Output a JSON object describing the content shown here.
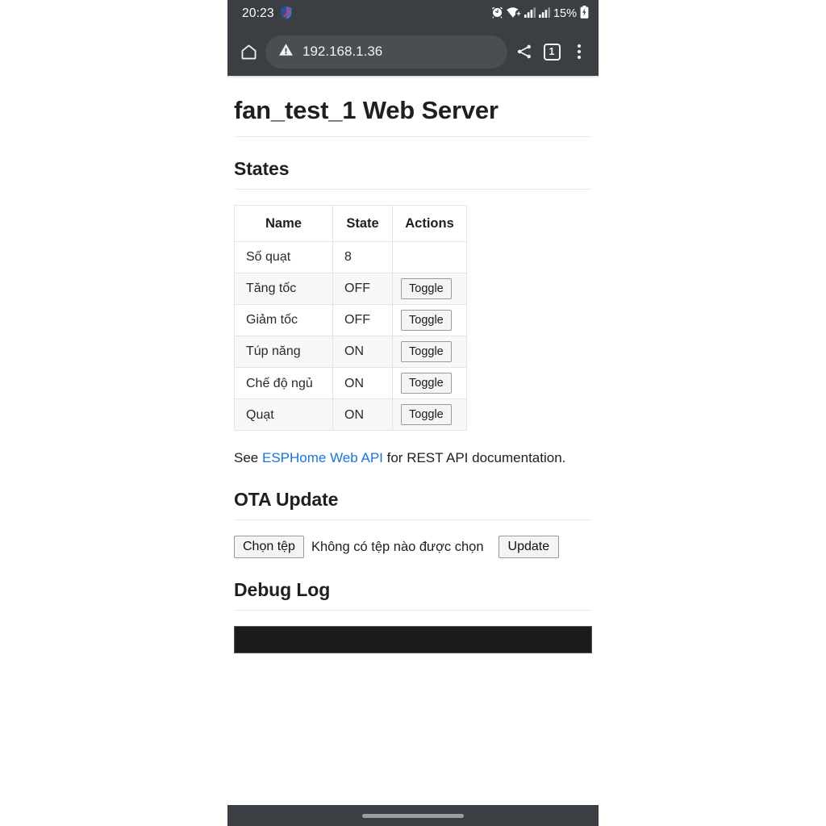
{
  "statusbar": {
    "clock": "20:23",
    "icons_left": [
      "shield-icon"
    ],
    "battery_percent": "15%",
    "icons_right": [
      "alarm-icon",
      "wifi-icon",
      "signal-bars-icon",
      "signal-bars-2-icon",
      "battery-charging-icon"
    ]
  },
  "browser": {
    "home_icon": "home-icon",
    "security_icon": "warning-triangle-icon",
    "url": "192.168.1.36",
    "share_icon": "share-icon",
    "tab_count": "1",
    "menu_icon": "kebab-menu-icon"
  },
  "page": {
    "title": "fan_test_1 Web Server",
    "states_heading": "States",
    "ota_heading": "OTA Update",
    "debug_heading": "Debug Log"
  },
  "states_table": {
    "columns": [
      "Name",
      "State",
      "Actions"
    ],
    "rows": [
      {
        "name": "Số quạt",
        "state": "8",
        "action": ""
      },
      {
        "name": "Tăng tốc",
        "state": "OFF",
        "action": "Toggle"
      },
      {
        "name": "Giảm tốc",
        "state": "OFF",
        "action": "Toggle"
      },
      {
        "name": "Túp năng",
        "state": "ON",
        "action": "Toggle"
      },
      {
        "name": "Chế độ ngủ",
        "state": "ON",
        "action": "Toggle"
      },
      {
        "name": "Quạt",
        "state": "ON",
        "action": "Toggle"
      }
    ]
  },
  "api_note": {
    "prefix": "See ",
    "link_text": "ESPHome Web API",
    "suffix": " for REST API documentation."
  },
  "ota": {
    "choose_file_label": "Chọn tệp",
    "file_status": "Không có tệp nào được chọn",
    "update_label": "Update"
  },
  "debug": {
    "log_text": ""
  },
  "colors": {
    "chrome_bar": "#3b3e43",
    "omnibox": "#4a4d52",
    "link": "#1a73e8",
    "table_border": "#e2e4e6",
    "row_alt": "#f7f8f9",
    "debug_bg": "#1b1b1b"
  }
}
